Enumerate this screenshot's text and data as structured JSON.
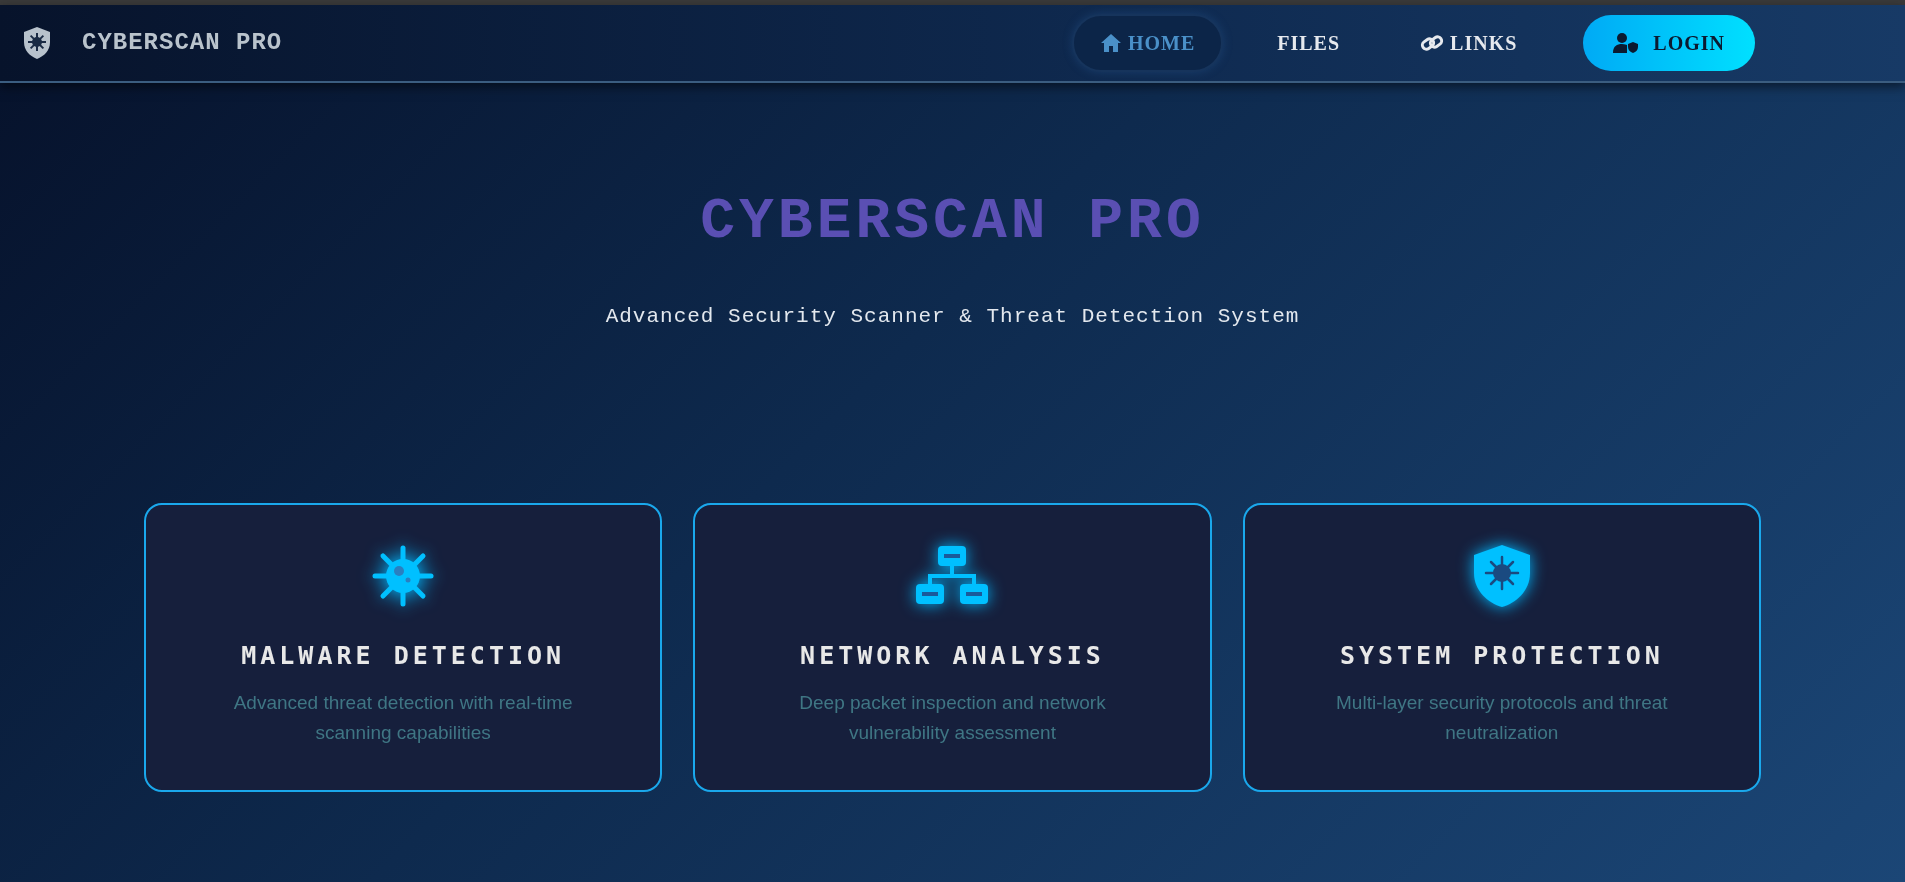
{
  "brand": {
    "name": "CYBERSCAN PRO"
  },
  "nav": [
    {
      "label": "HOME",
      "kind": "home",
      "selected": true
    },
    {
      "label": "FILES",
      "kind": "plain",
      "selected": false
    },
    {
      "label": "LINKS",
      "kind": "link",
      "selected": false
    }
  ],
  "login": {
    "label": "LOGIN"
  },
  "hero": {
    "title": "CYBERSCAN PRO",
    "subtitle": "Advanced Security Scanner & Threat Detection System"
  },
  "features": [
    {
      "kind": "virus",
      "title": "MALWARE DETECTION",
      "description": "Advanced threat detection with real-time scanning capabilities"
    },
    {
      "kind": "network",
      "title": "NETWORK ANALYSIS",
      "description": "Deep packet inspection and network vulnerability assessment"
    },
    {
      "kind": "shield",
      "title": "SYSTEM PROTECTION",
      "description": "Multi-layer security protocols and threat neutralization"
    }
  ]
}
